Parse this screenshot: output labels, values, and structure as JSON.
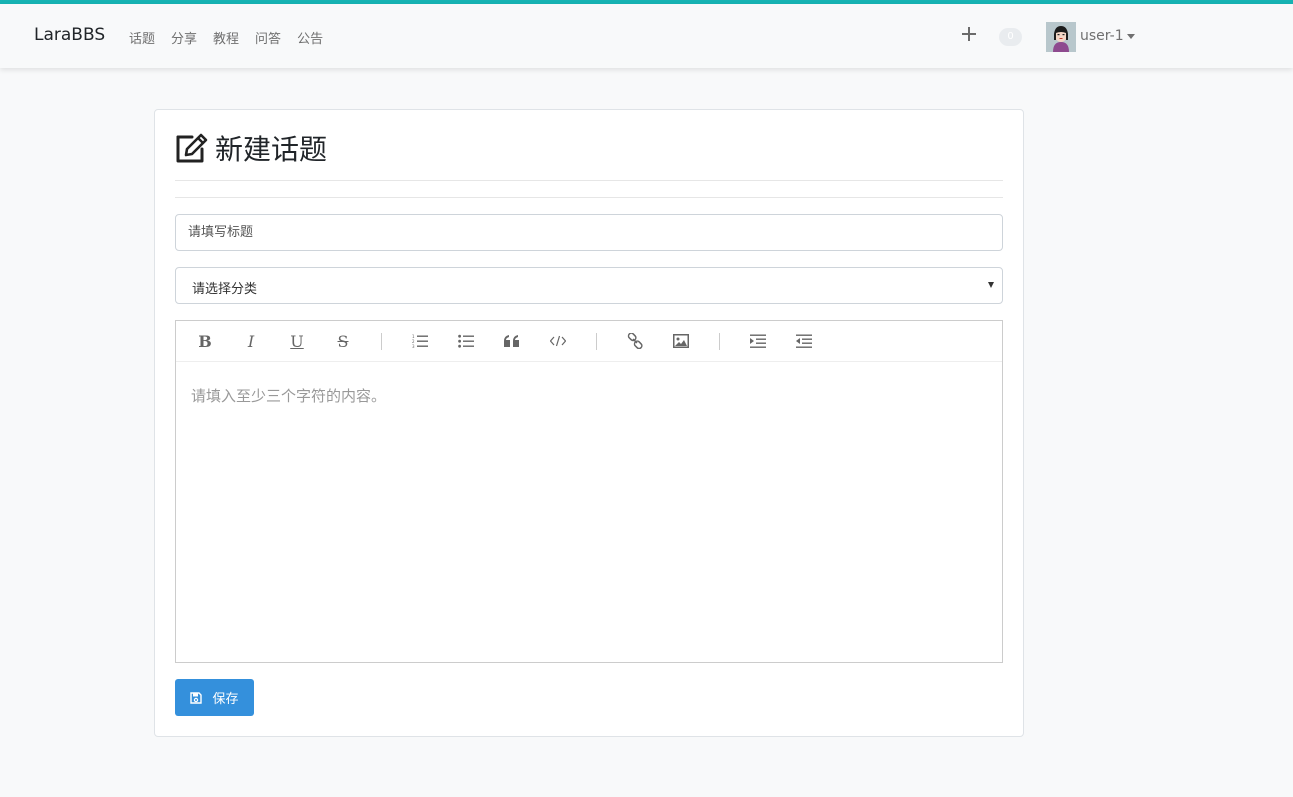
{
  "navbar": {
    "brand": "LaraBBS",
    "links": [
      "话题",
      "分享",
      "教程",
      "问答",
      "公告"
    ],
    "notification_count": "0",
    "username": "user-1"
  },
  "page": {
    "title": "新建话题"
  },
  "form": {
    "title_placeholder": "请填写标题",
    "category_selected": "请选择分类",
    "editor_placeholder": "请填入至少三个字符的内容。",
    "save_label": "保存"
  },
  "editor_toolbar": {
    "icons": [
      "bold-icon",
      "italic-icon",
      "underline-icon",
      "strikethrough-icon",
      "ordered-list-icon",
      "unordered-list-icon",
      "blockquote-icon",
      "code-icon",
      "link-icon",
      "image-icon",
      "indent-icon",
      "outdent-icon"
    ]
  },
  "colors": {
    "accent": "#3490dc",
    "top_border": "#17b3b3"
  }
}
